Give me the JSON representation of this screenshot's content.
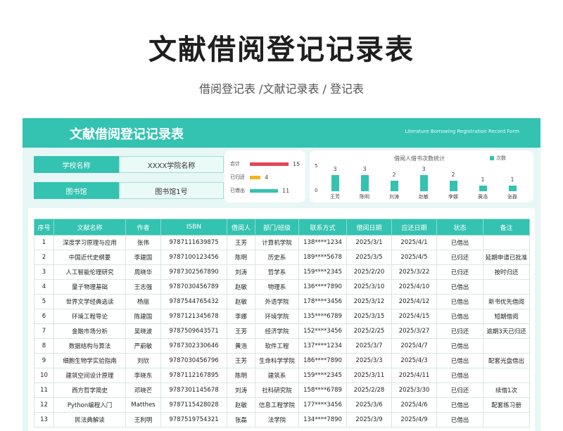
{
  "page": {
    "title": "文献借阅登记记录表",
    "subtitle": "借阅登记表 /文献记录表 / 登记表"
  },
  "banner": {
    "title": "文献借阅登记记录表",
    "subtitle_en": "Literature Borrowing Registration Record Form"
  },
  "info": {
    "school_label": "学校名称",
    "school_value": "XXXX学院名称",
    "library_label": "图书馆",
    "library_value": "图书馆1号"
  },
  "stats": [
    {
      "label": "合计",
      "value": 15,
      "color": "#e0475a"
    },
    {
      "label": "已归还",
      "value": 4,
      "color": "#f2b51b"
    },
    {
      "label": "已借出",
      "value": 11,
      "color": "#34c2b1"
    }
  ],
  "chart_data": {
    "type": "bar",
    "title": "借阅人借书次数统计",
    "legend": "次数",
    "legend_position": "top-right",
    "categories": [
      "王芳",
      "陈明",
      "刘涛",
      "赵敏",
      "李娜",
      "黄浩",
      "张磊"
    ],
    "values": [
      3,
      3,
      2,
      3,
      2,
      1,
      1
    ],
    "y_ticks": [
      "5",
      "0"
    ],
    "ylim": [
      0,
      5
    ],
    "color": "#34c2b1"
  },
  "table": {
    "headers": [
      "序号",
      "文献名称",
      "作者",
      "ISBN",
      "借阅人",
      "部门/班级",
      "联系方式",
      "借阅日期",
      "应还日期",
      "状态",
      "备注"
    ],
    "rows": [
      [
        "1",
        "深度学习原理与应用",
        "张伟",
        "9787111639875",
        "王芳",
        "计算机学院",
        "138****1234",
        "2025/3/1",
        "2025/4/1",
        "已借出",
        ""
      ],
      [
        "2",
        "中国近代史纲要",
        "李建国",
        "9787100123456",
        "陈明",
        "历史系",
        "189****5678",
        "2025/3/5",
        "2025/4/5",
        "已归还",
        "延期申请已批准"
      ],
      [
        "3",
        "人工智能伦理研究",
        "周晓华",
        "9787302567890",
        "刘涛",
        "哲学系",
        "159****2345",
        "2025/2/20",
        "2025/3/22",
        "已归还",
        "按时归还"
      ],
      [
        "4",
        "量子物理基础",
        "王志强",
        "9787030456789",
        "赵敏",
        "物理系",
        "136****7890",
        "2025/3/10",
        "2025/4/10",
        "已借出",
        ""
      ],
      [
        "5",
        "世界文学经典选读",
        "杨丽",
        "9787544765432",
        "赵敏",
        "外语学院",
        "178****3456",
        "2025/3/12",
        "2025/4/12",
        "已借出",
        "新书优先借阅"
      ],
      [
        "6",
        "环境工程导论",
        "陈建国",
        "9787121345678",
        "李娜",
        "环境学院",
        "135****6789",
        "2025/3/15",
        "2025/4/15",
        "已借出",
        "短期借阅"
      ],
      [
        "7",
        "金融市场分析",
        "吴晓波",
        "9787509643571",
        "王芳",
        "经济学院",
        "152****3456",
        "2025/2/25",
        "2025/3/27",
        "已归还",
        "逾期3天已归还"
      ],
      [
        "8",
        "数据结构与算法",
        "严蔚敏",
        "9787302330646",
        "黄浩",
        "软件工程",
        "137****1234",
        "2025/3/7",
        "2025/4/7",
        "已借出",
        ""
      ],
      [
        "9",
        "细胞生物学实验指南",
        "刘欣",
        "9787030456796",
        "王芳",
        "生命科学学院",
        "186****7890",
        "2025/3/3",
        "2025/4/3",
        "已借出",
        "配套光盘借出"
      ],
      [
        "10",
        "建筑空间设计原理",
        "李晓东",
        "9787112167895",
        "陈明",
        "建筑系",
        "159****2345",
        "2025/3/11",
        "2025/4/11",
        "已借出",
        ""
      ],
      [
        "11",
        "西方哲学简史",
        "邓晓芒",
        "9787301145678",
        "刘涛",
        "社科研究院",
        "158****6789",
        "2025/2/28",
        "2025/3/30",
        "已归还",
        "续借1次"
      ],
      [
        "12",
        "Python编程入门",
        "Matthes",
        "9787115428028",
        "赵敏",
        "信息工程学院",
        "177****3456",
        "2025/3/6",
        "2025/4/6",
        "已借出",
        "配套练习册"
      ],
      [
        "13",
        "民法典解读",
        "王利明",
        "9787519754321",
        "张磊",
        "法学院",
        "134****7890",
        "2025/3/9",
        "2025/4/9",
        "已借出",
        ""
      ]
    ]
  }
}
